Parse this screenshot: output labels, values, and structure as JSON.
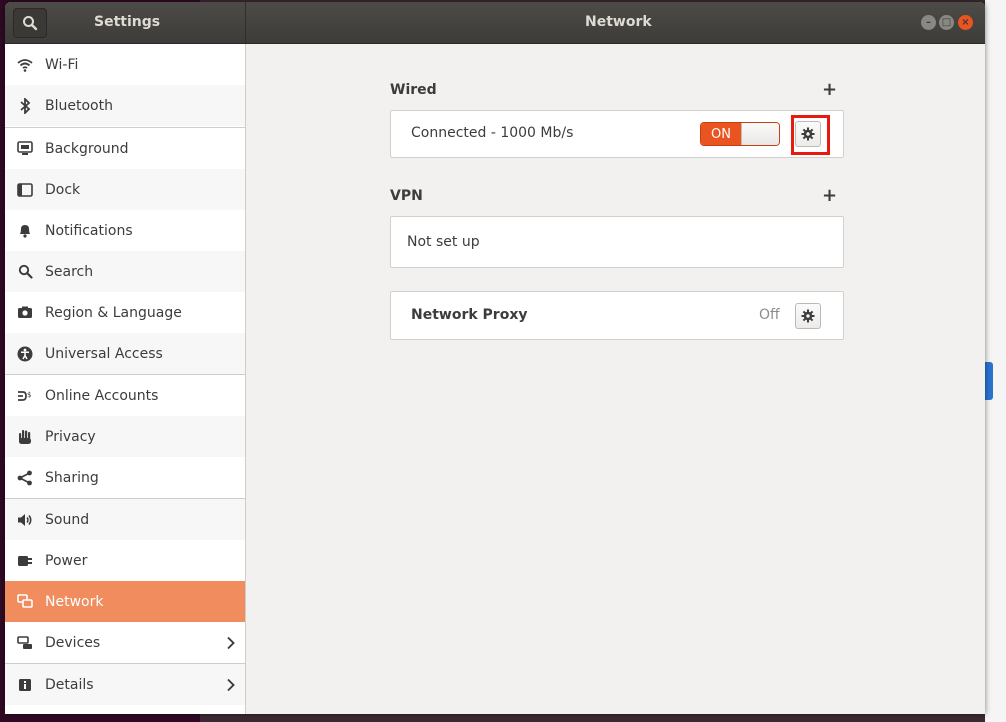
{
  "header": {
    "sidebar_title": "Settings",
    "page_title": "Network"
  },
  "sidebar": {
    "items": [
      {
        "label": "Wi-Fi",
        "icon": "wifi-icon"
      },
      {
        "label": "Bluetooth",
        "icon": "bluetooth-icon"
      },
      {
        "label": "Background",
        "icon": "background-icon"
      },
      {
        "label": "Dock",
        "icon": "dock-icon"
      },
      {
        "label": "Notifications",
        "icon": "bell-icon"
      },
      {
        "label": "Search",
        "icon": "search-icon"
      },
      {
        "label": "Region & Language",
        "icon": "camera-icon"
      },
      {
        "label": "Universal Access",
        "icon": "accessibility-icon"
      },
      {
        "label": "Online Accounts",
        "icon": "online-accounts-icon"
      },
      {
        "label": "Privacy",
        "icon": "hand-icon"
      },
      {
        "label": "Sharing",
        "icon": "share-icon"
      },
      {
        "label": "Sound",
        "icon": "speaker-icon"
      },
      {
        "label": "Power",
        "icon": "plug-icon"
      },
      {
        "label": "Network",
        "icon": "network-icon",
        "active": true
      },
      {
        "label": "Devices",
        "icon": "devices-icon"
      },
      {
        "label": "Details",
        "icon": "info-icon"
      }
    ]
  },
  "wired": {
    "title": "Wired",
    "add_symbol": "+",
    "status": "Connected - 1000 Mb/s",
    "toggle_label": "ON"
  },
  "vpn": {
    "title": "VPN",
    "add_symbol": "+",
    "status": "Not set up"
  },
  "proxy": {
    "title": "Network Proxy",
    "status": "Off"
  },
  "colors": {
    "accent": "#e95420",
    "active_row": "#f08c5e",
    "highlight_box": "#e8190e"
  }
}
